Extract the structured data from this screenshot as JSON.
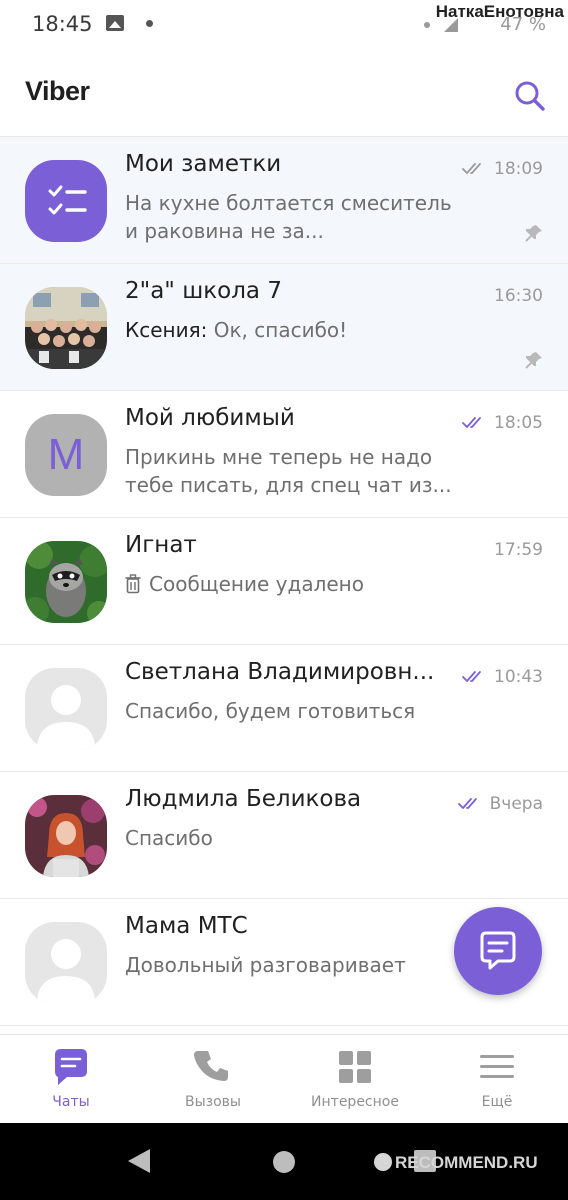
{
  "status_bar": {
    "time": "18:45",
    "battery": "47 %",
    "watermark_user": "НаткаЕнотовна"
  },
  "header": {
    "title": "Viber"
  },
  "chats": [
    {
      "name": "Мои заметки",
      "sender": "",
      "preview": "На кухне болтается смеситель и раковина не за...",
      "time": "18:09",
      "read": "grey",
      "pinned": true,
      "avatar": "notes-icon"
    },
    {
      "name": "2\"а\" школа  7",
      "sender": "Ксения: ",
      "preview": "Ок, спасибо!",
      "time": "16:30",
      "read": "",
      "pinned": true,
      "avatar": "group-photo"
    },
    {
      "name": "Мой любимый",
      "sender": "",
      "preview": "Прикинь мне теперь не надо тебе писать, для спец чат из...",
      "time": "18:05",
      "read": "purple",
      "pinned": false,
      "avatar": "M"
    },
    {
      "name": "Игнат",
      "sender": "",
      "preview": "Сообщение удалено",
      "time": "17:59",
      "read": "",
      "pinned": false,
      "avatar": "raccoon-photo"
    },
    {
      "name": "Светлана Владимировн...",
      "sender": "",
      "preview": "Спасибо, будем готовиться",
      "time": "10:43",
      "read": "purple",
      "pinned": false,
      "avatar": "default-avatar"
    },
    {
      "name": "Людмила Беликова",
      "sender": "",
      "preview": "Спасибо",
      "time": "Вчера",
      "read": "purple",
      "pinned": false,
      "avatar": "girl-photo"
    },
    {
      "name": "Мама МТС",
      "sender": "",
      "preview": "Довольный разговаривает",
      "time": "",
      "read": "",
      "pinned": false,
      "avatar": "default-avatar"
    }
  ],
  "nav": {
    "chats": "Чаты",
    "calls": "Вызовы",
    "explore": "Интересное",
    "more": "Ещё"
  },
  "colors": {
    "accent": "#7b5fd6",
    "pinned_bg": "#f4f7fc"
  },
  "watermark_site": "RECOMMEND.RU"
}
